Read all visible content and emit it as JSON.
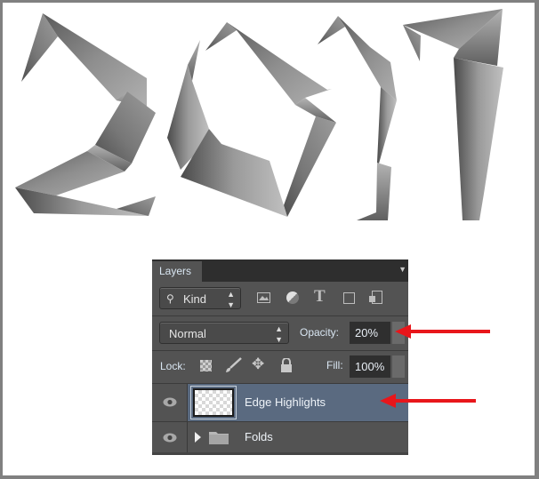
{
  "artwork": {
    "subject": "2017",
    "style": "folded paper ribbon digits",
    "colors": {
      "light": "#b5b5b5",
      "mid": "#8a8a8a",
      "dark": "#555555"
    }
  },
  "layers_panel": {
    "tab_label": "Layers",
    "filter": {
      "label": "Kind",
      "icons": [
        "search-icon",
        "image-filter-icon",
        "adjustment-filter-icon",
        "type-filter-icon",
        "shape-filter-icon",
        "smart-object-filter-icon"
      ],
      "type_glyph": "T"
    },
    "blend_mode": {
      "value": "Normal"
    },
    "opacity": {
      "label": "Opacity:",
      "value": "20%"
    },
    "lock": {
      "label": "Lock:",
      "icons": [
        "lock-transparent-pixels-icon",
        "lock-image-pixels-icon",
        "lock-position-icon",
        "lock-all-icon"
      ]
    },
    "fill": {
      "label": "Fill:",
      "value": "100%"
    },
    "layers": [
      {
        "name": "Edge Highlights",
        "type": "layer",
        "visible": true,
        "selected": true
      },
      {
        "name": "Folds",
        "type": "group",
        "visible": true,
        "selected": false,
        "expanded": false
      }
    ]
  },
  "annotations": {
    "arrow_color": "#e8161b",
    "arrows": [
      {
        "points_to": "opacity-field"
      },
      {
        "points_to": "layer-edge-highlights"
      }
    ]
  },
  "colors": {
    "panel_bg": "#535353",
    "selected_row": "#5a6a80",
    "frame": "#808080"
  }
}
